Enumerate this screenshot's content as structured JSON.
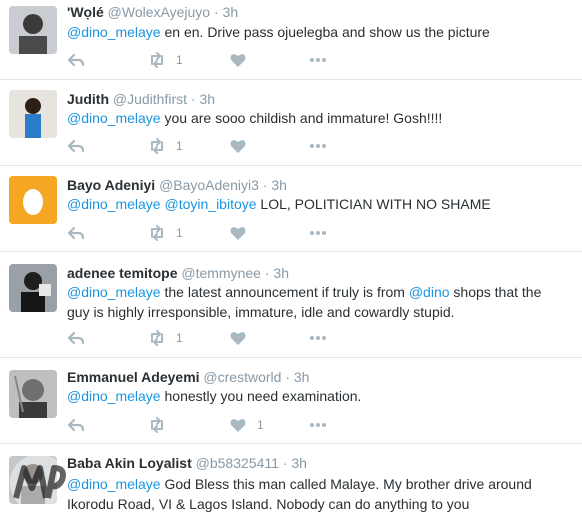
{
  "tweets": [
    {
      "name": "'Wọlé",
      "handle": "@WolexAyejuyo",
      "time": "3h",
      "parts": [
        {
          "t": "mention",
          "v": "@dino_melaye"
        },
        {
          "t": "text",
          "v": " en en. Drive pass ojuelegba and show us the picture"
        }
      ],
      "retweets": "1",
      "likes": ""
    },
    {
      "name": "Judith",
      "handle": "@Judithfirst",
      "time": "3h",
      "parts": [
        {
          "t": "mention",
          "v": "@dino_melaye"
        },
        {
          "t": "text",
          "v": " you are sooo childish and immature! Gosh!!!!"
        }
      ],
      "retweets": "1",
      "likes": ""
    },
    {
      "name": "Bayo Adeniyi",
      "handle": "@BayoAdeniyi3",
      "time": "3h",
      "parts": [
        {
          "t": "mention",
          "v": "@dino_melaye"
        },
        {
          "t": "text",
          "v": " "
        },
        {
          "t": "mention",
          "v": "@toyin_ibitoye"
        },
        {
          "t": "text",
          "v": " LOL, POLITICIAN WITH NO SHAME"
        }
      ],
      "retweets": "1",
      "likes": ""
    },
    {
      "name": "adenee temitope",
      "handle": "@temmynee",
      "time": "3h",
      "parts": [
        {
          "t": "mention",
          "v": "@dino_melaye"
        },
        {
          "t": "text",
          "v": " the latest announcement if truly is from "
        },
        {
          "t": "mention",
          "v": "@dino"
        },
        {
          "t": "text",
          "v": " shops that the guy is highly irresponsible, immature, idle and cowardly stupid."
        }
      ],
      "retweets": "1",
      "likes": ""
    },
    {
      "name": "Emmanuel Adeyemi",
      "handle": "@crestworld",
      "time": "3h",
      "parts": [
        {
          "t": "mention",
          "v": "@dino_melaye"
        },
        {
          "t": "text",
          "v": " honestly you need examination."
        }
      ],
      "retweets": "",
      "likes": "1"
    },
    {
      "name": "Baba Akin Loyalist",
      "handle": "@b58325411",
      "time": "3h",
      "parts": [
        {
          "t": "mention",
          "v": "@dino_melaye"
        },
        {
          "t": "text",
          "v": " God Bless this man called Malaye. My brother drive around Ikorodu Road, VI & Lagos Island. Nobody can do anything to you"
        }
      ],
      "retweets": "",
      "likes": ""
    }
  ],
  "separator": "·",
  "icons": {
    "reply": "reply-icon",
    "retweet": "retweet-icon",
    "like": "heart-icon",
    "more": "more-dots-icon"
  },
  "colors": {
    "mention": "#1b95e0",
    "meta": "#8899a6",
    "icon": "#aab8c2",
    "egg_bg": "#f5a623"
  }
}
